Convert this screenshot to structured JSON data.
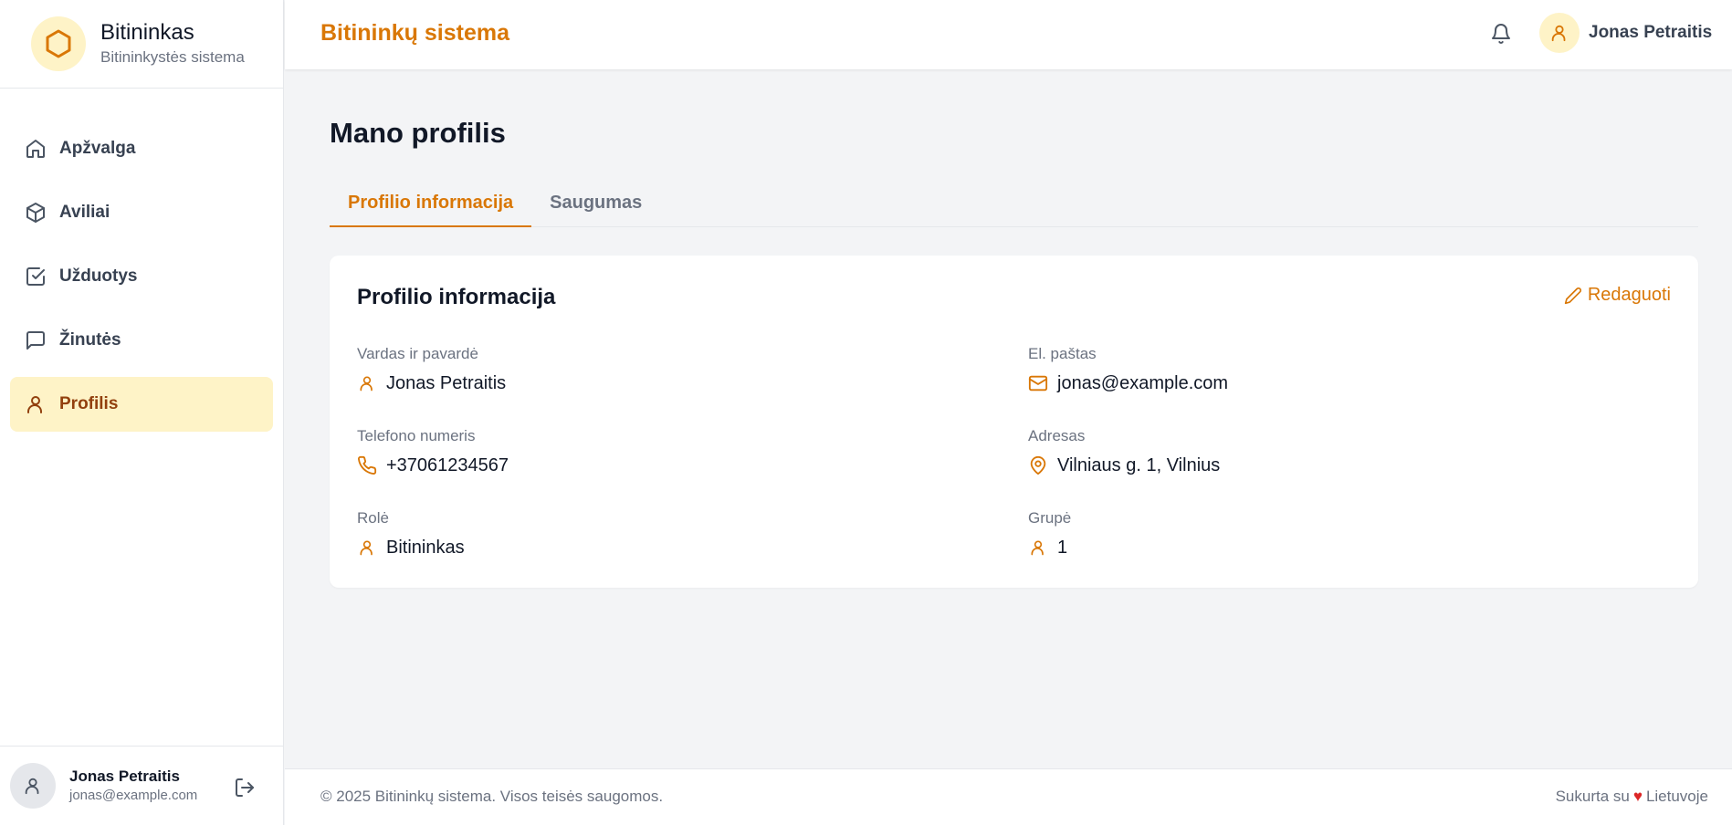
{
  "brand": {
    "name": "Bitininkas",
    "subtitle": "Bitininkystės sistema"
  },
  "nav": [
    {
      "label": "Apžvalga",
      "icon": "home-icon"
    },
    {
      "label": "Aviliai",
      "icon": "box-icon"
    },
    {
      "label": "Užduotys",
      "icon": "check-square-icon"
    },
    {
      "label": "Žinutės",
      "icon": "message-icon"
    },
    {
      "label": "Profilis",
      "icon": "user-icon",
      "active": true
    }
  ],
  "sidebar_user": {
    "name": "Jonas Petraitis",
    "email": "jonas@example.com"
  },
  "header": {
    "title": "Bitininkų sistema",
    "user_name": "Jonas Petraitis"
  },
  "page": {
    "title": "Mano profilis"
  },
  "tabs": [
    {
      "label": "Profilio informacija",
      "active": true
    },
    {
      "label": "Saugumas",
      "active": false
    }
  ],
  "card": {
    "title": "Profilio informacija",
    "edit_label": "Redaguoti",
    "fields": {
      "name": {
        "label": "Vardas ir pavardė",
        "value": "Jonas Petraitis",
        "icon": "user-icon"
      },
      "email": {
        "label": "El. paštas",
        "value": "jonas@example.com",
        "icon": "mail-icon"
      },
      "phone": {
        "label": "Telefono numeris",
        "value": "+37061234567",
        "icon": "phone-icon"
      },
      "address": {
        "label": "Adresas",
        "value": "Vilniaus g. 1, Vilnius",
        "icon": "map-pin-icon"
      },
      "role": {
        "label": "Rolė",
        "value": "Bitininkas",
        "icon": "user-icon"
      },
      "group": {
        "label": "Grupė",
        "value": "1",
        "icon": "user-icon"
      }
    }
  },
  "footer": {
    "copyright": "© 2025 Bitininkų sistema. Visos teisės saugomos.",
    "made_prefix": "Sukurta su",
    "heart": "♥",
    "made_suffix": "Lietuvoje"
  },
  "colors": {
    "accent": "#d97706",
    "accent_light": "#fef3c7",
    "active_text": "#92400e"
  }
}
